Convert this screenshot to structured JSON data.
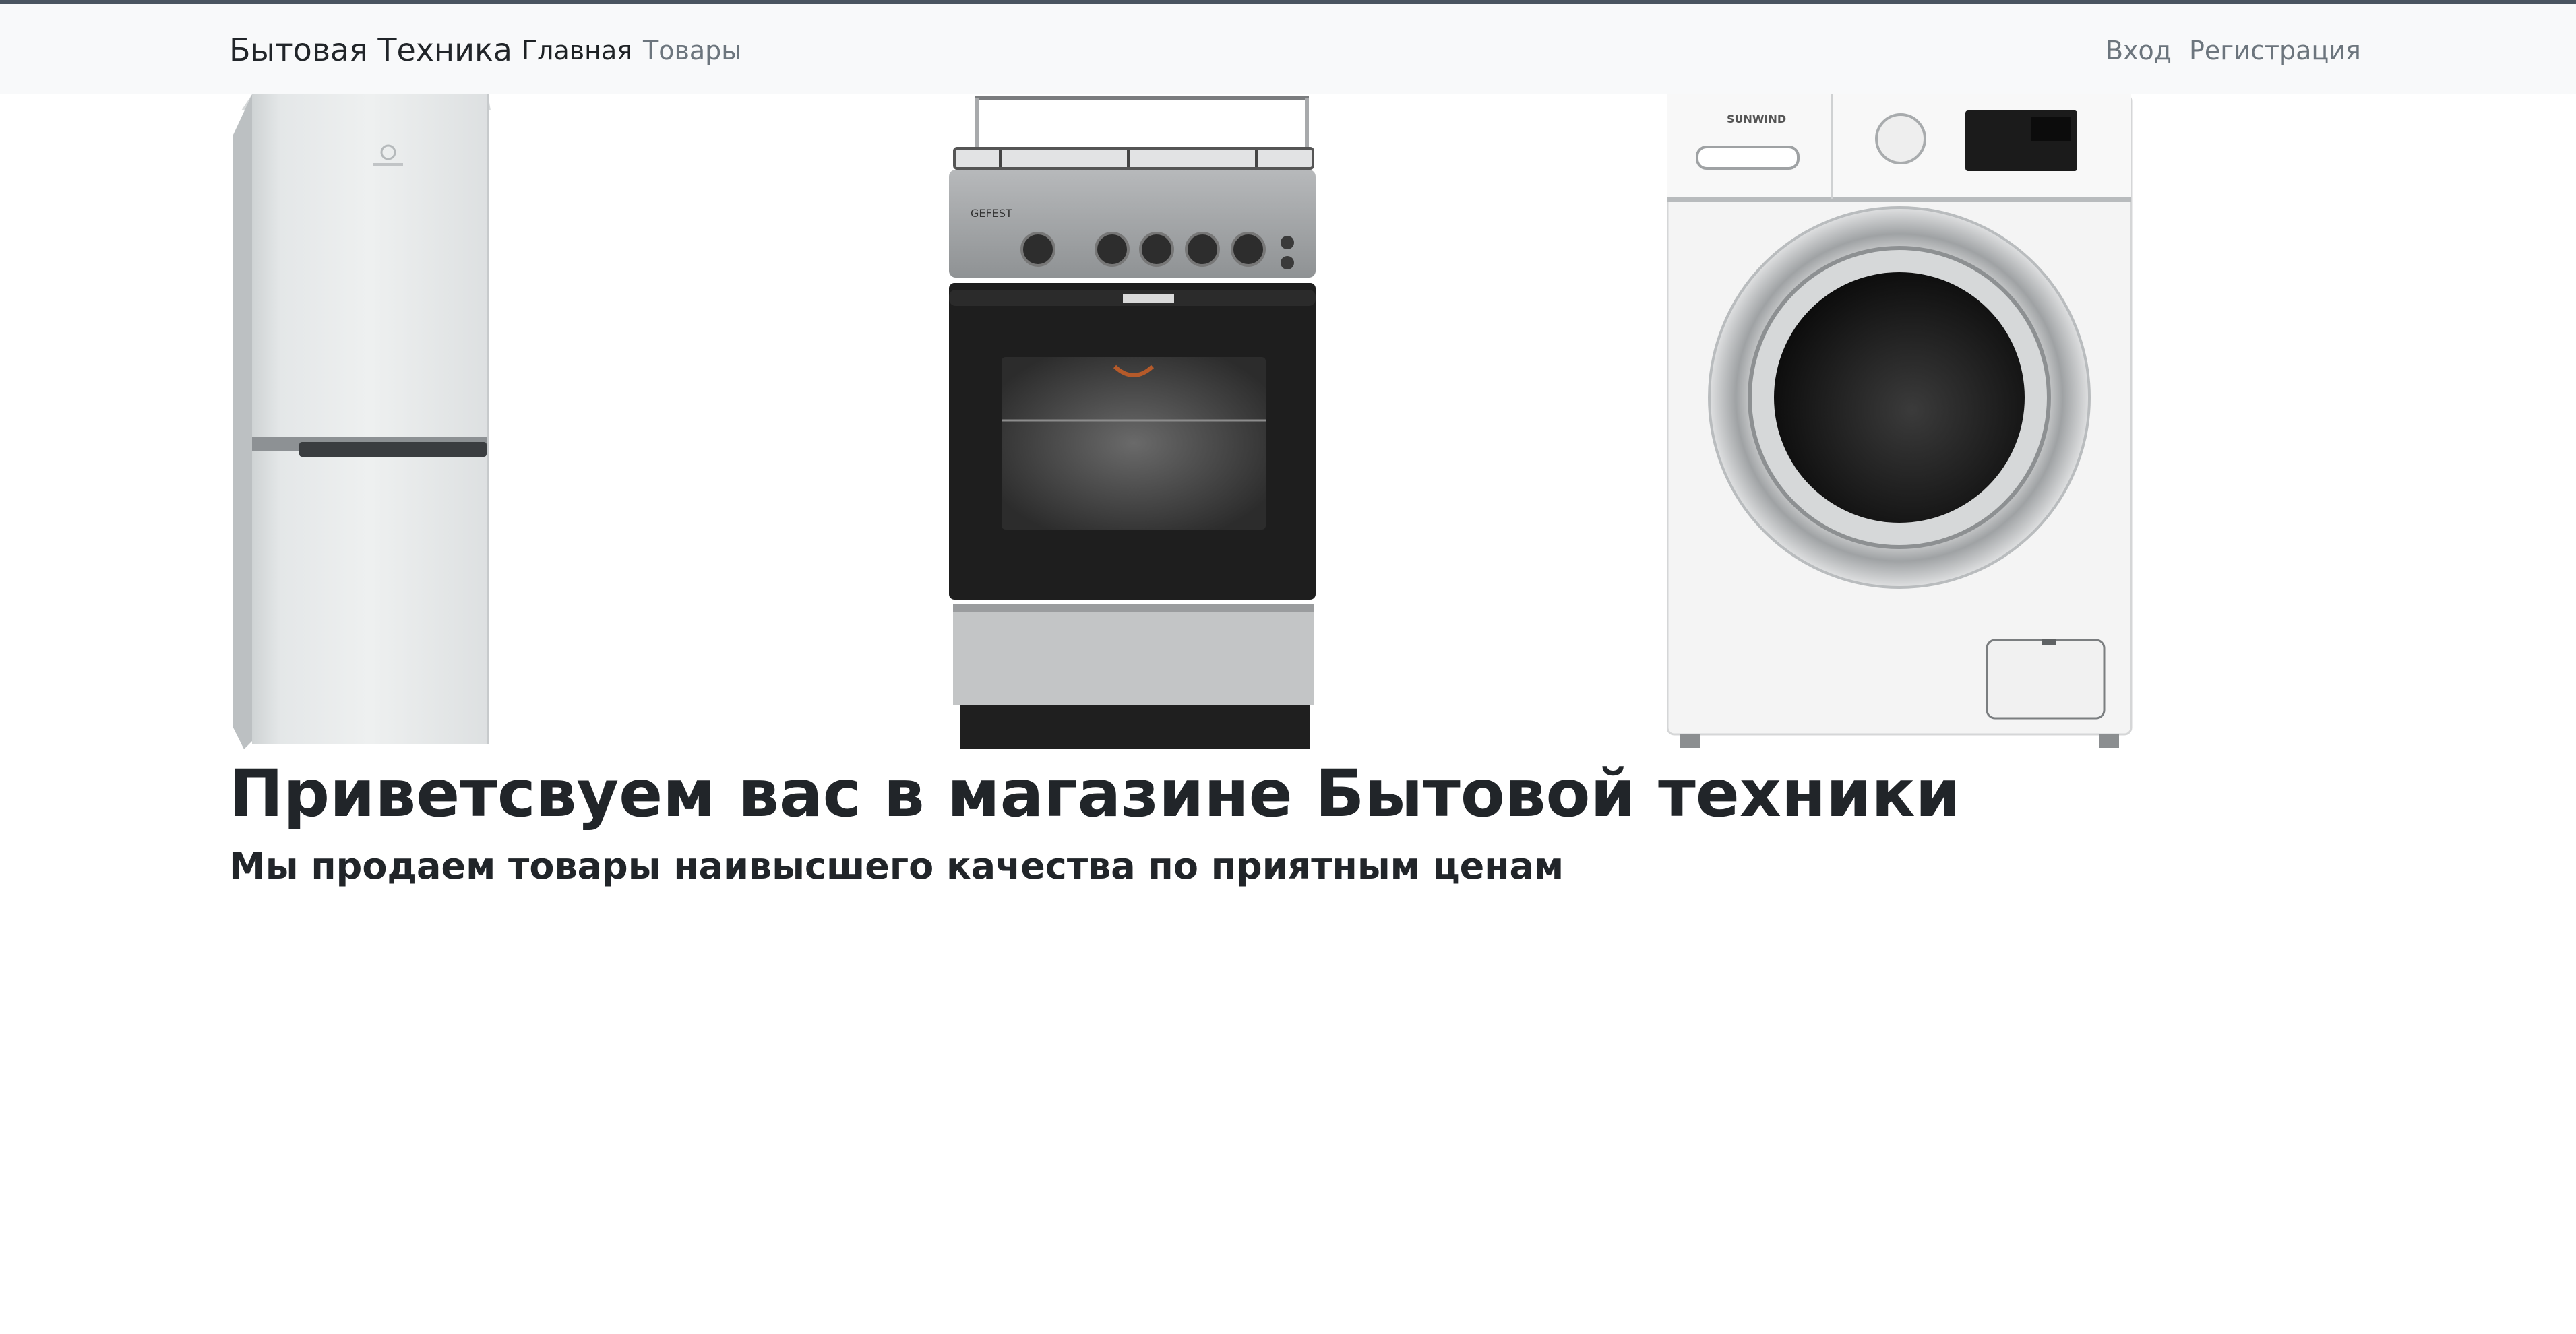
{
  "navbar": {
    "brand": "Бытовая Техника",
    "links": [
      {
        "label": "Главная",
        "active": true
      },
      {
        "label": "Товары",
        "active": false
      }
    ],
    "auth": {
      "login": "Вход",
      "register": "Регистрация"
    }
  },
  "products": [
    {
      "icon": "refrigerator-image",
      "brand_mark": ""
    },
    {
      "icon": "gas-stove-image",
      "brand_mark": "GEFEST"
    },
    {
      "icon": "washing-machine-image",
      "brand_mark": "SUNWIND"
    }
  ],
  "hero": {
    "title": "Приветсвуем вас в магазине Бытовой техники",
    "subtitle": "Мы продаем товары наивысшего качества по приятным ценам"
  },
  "colors": {
    "navbar_bg": "#f8f9fa",
    "text": "#212529",
    "muted": "#6c757d",
    "top_border": "#4a5561"
  }
}
